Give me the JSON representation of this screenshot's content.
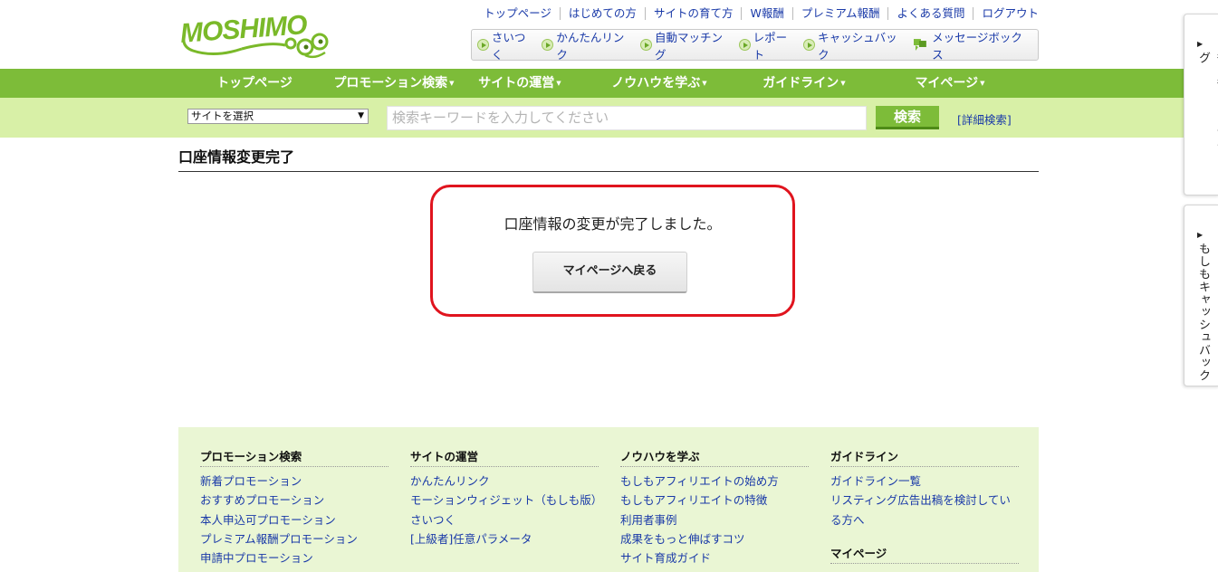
{
  "header": {
    "logo_text": "MOSHIMO",
    "top_links": [
      "トップページ",
      "はじめての方",
      "サイトの育て方",
      "W報酬",
      "プレミアム報酬",
      "よくある質問",
      "ログアウト"
    ],
    "tools": [
      "さいつく",
      "かんたんリンク",
      "自動マッチング",
      "レポート",
      "キャッシュバック"
    ],
    "message_box": "メッセージボックス"
  },
  "nav": {
    "items": [
      {
        "label": "トップページ",
        "dropdown": false
      },
      {
        "label": "プロモーション検索",
        "dropdown": true
      },
      {
        "label": "サイトの運営",
        "dropdown": true
      },
      {
        "label": "ノウハウを学ぶ",
        "dropdown": true
      },
      {
        "label": "ガイドライン",
        "dropdown": true
      },
      {
        "label": "マイページ",
        "dropdown": true
      }
    ],
    "dropdown_marker": "▼"
  },
  "search": {
    "site_select": "サイトを選択",
    "keyword_placeholder": "検索キーワードを入力してください",
    "button": "検索",
    "advanced": "[詳細検索]"
  },
  "main": {
    "page_title": "口座情報変更完了",
    "message": "口座情報の変更が完了しました。",
    "back_button": "マイページへ戻る"
  },
  "footer": {
    "promotion": {
      "title": "プロモーション検索",
      "links": [
        "新着プロモーション",
        "おすすめプロモーション",
        "本人申込可プロモーション",
        "プレミアム報酬プロモーション",
        "申請中プロモーション"
      ]
    },
    "site": {
      "title": "サイトの運営",
      "links": [
        "かんたんリンク",
        "モーションウィジェット（もしも版）",
        "さいつく",
        "[上級者]任意パラメータ"
      ]
    },
    "knowhow": {
      "title": "ノウハウを学ぶ",
      "links": [
        "もしもアフィリエイトの始め方",
        "もしもアフィリエイトの特徴",
        "利用者事例",
        "成果をもっと伸ばすコツ",
        "サイト育成ガイド"
      ]
    },
    "guideline": {
      "title": "ガイドライン",
      "links": [
        "ガイドライン一覧",
        "リスティング広告出稿を検討している方へ"
      ]
    },
    "mypage": {
      "title": "マイページ"
    }
  },
  "side_tabs": {
    "arrow": "▶",
    "dropshipping": "もしもドロップシッピング",
    "cashback": "もしもキャッシュバック"
  },
  "colors": {
    "brand_green": "#7dbc39",
    "light_green": "#d8f0a7",
    "footer_bg": "#eaf6d4",
    "highlight_red": "#e0141e",
    "link_blue": "#1a3aa8"
  }
}
